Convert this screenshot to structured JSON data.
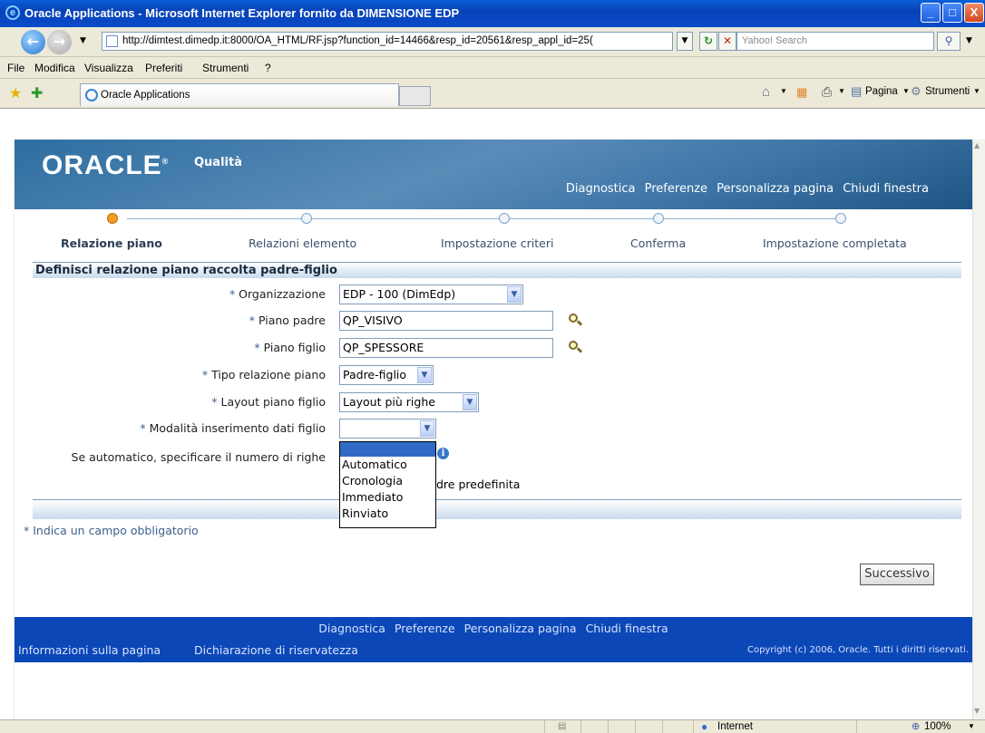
{
  "window": {
    "title": "Oracle Applications - Microsoft Internet Explorer fornito da DIMENSIONE EDP"
  },
  "browser": {
    "address": "http://dimtest.dimedp.it:8000/OA_HTML/RF.jsp?function_id=14466&resp_id=20561&resp_appl_id=25(",
    "search_placeholder": "Yahoo! Search",
    "menu": [
      "File",
      "Modifica",
      "Visualizza",
      "Preferiti",
      "Strumenti",
      "?"
    ],
    "tab_title": "Oracle Applications",
    "toolbar_pagina": "Pagina",
    "toolbar_strumenti": "Strumenti"
  },
  "oracle": {
    "logo": "ORACLE",
    "app_name": "Qualità",
    "global_links": [
      "Diagnostica",
      "Preferenze",
      "Personalizza pagina",
      "Chiudi finestra"
    ]
  },
  "train": {
    "steps": [
      "Relazione piano",
      "Relazioni elemento",
      "Impostazione criteri",
      "Conferma",
      "Impostazione completata"
    ],
    "current_index": 0
  },
  "section": {
    "title": "Definisci relazione piano raccolta padre-figlio"
  },
  "form": {
    "required_mark": "*",
    "organizzazione": {
      "label": "Organizzazione",
      "value": "EDP - 100 (DimEdp)"
    },
    "piano_padre": {
      "label": "Piano padre",
      "value": "QP_VISIVO"
    },
    "piano_figlio": {
      "label": "Piano figlio",
      "value": "QP_SPESSORE"
    },
    "tipo_relazione": {
      "label": "Tipo relazione piano",
      "value": "Padre-figlio"
    },
    "layout_piano": {
      "label": "Layout piano figlio",
      "value": "Layout più righe"
    },
    "modalita": {
      "label": "Modalità inserimento dati figlio",
      "value": "",
      "options": [
        "",
        "Automatico",
        "Cronologia",
        "Immediato",
        "Rinviato"
      ]
    },
    "numero_righe": {
      "label": "Se automatico, specificare il numero di righe"
    },
    "partial_text": "dre predefinita"
  },
  "required_note": "* Indica un campo obbligatorio",
  "next_button": "Successivo",
  "footer": {
    "links": [
      "Diagnostica",
      "Preferenze",
      "Personalizza pagina",
      "Chiudi finestra"
    ],
    "about": "Informazioni sulla pagina",
    "privacy": "Dichiarazione di riservatezza",
    "copyright": "Copyright (c) 2006, Oracle. Tutti i diritti riservati."
  },
  "status": {
    "zone": "Internet",
    "zoom": "100%"
  },
  "colors": {
    "footer_bg": "#0c47b8",
    "train_current": "#f39c1f",
    "header_bg": "#3f77a8"
  }
}
